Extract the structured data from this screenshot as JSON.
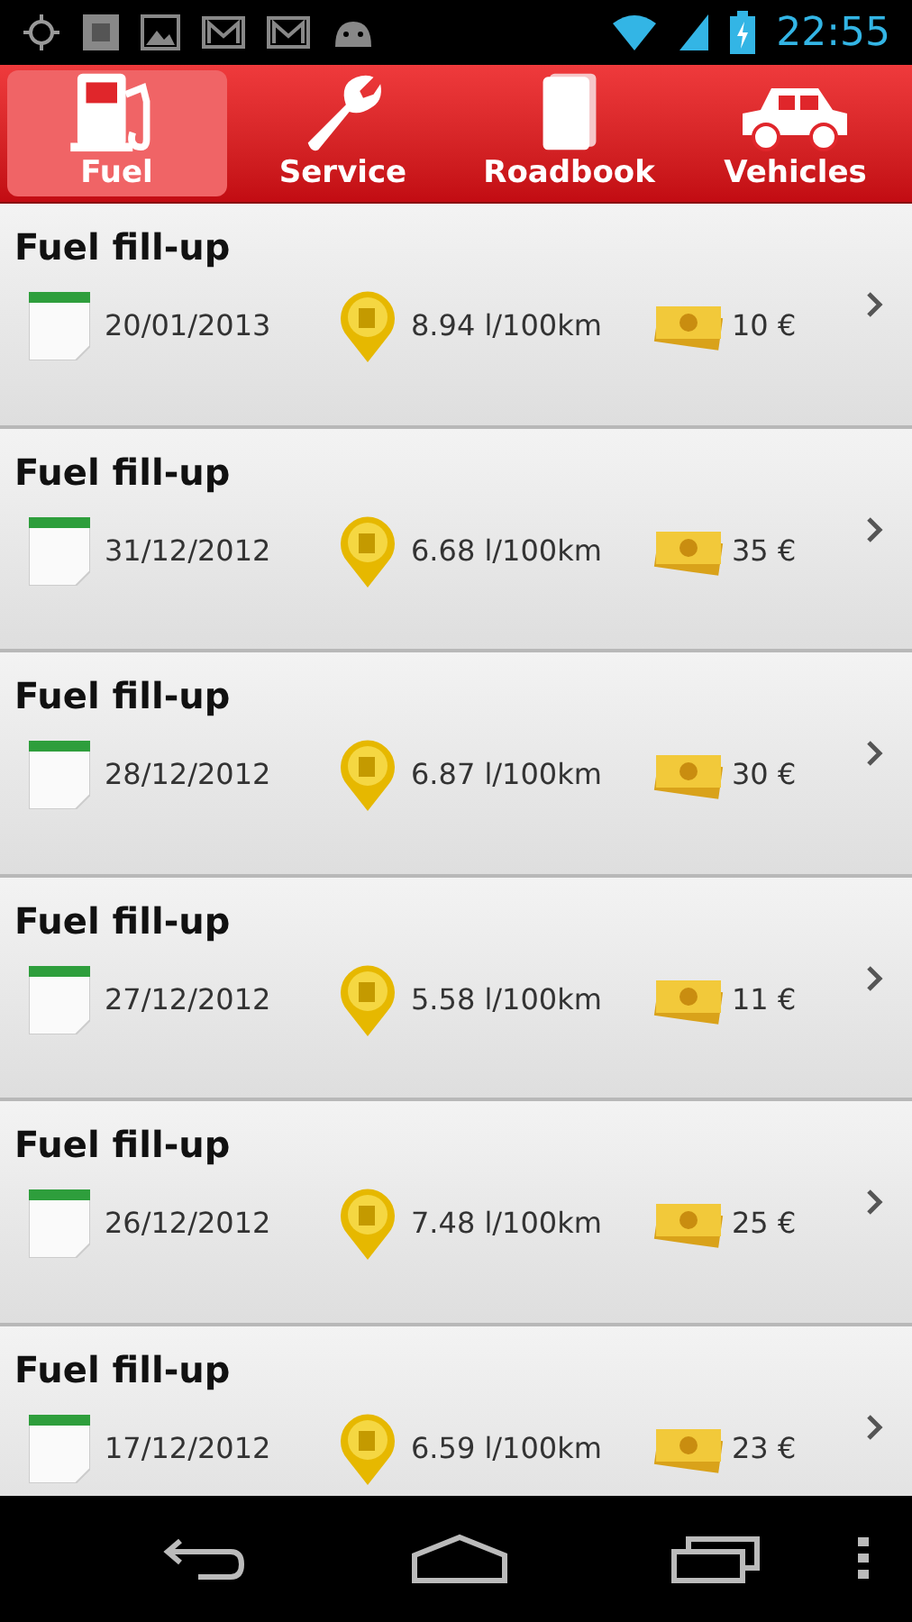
{
  "status_bar": {
    "time": "22:55"
  },
  "tabs": [
    {
      "label": "Fuel",
      "kind": "fuel",
      "selected": true
    },
    {
      "label": "Service",
      "kind": "service",
      "selected": false
    },
    {
      "label": "Roadbook",
      "kind": "roadbook",
      "selected": false
    },
    {
      "label": "Vehicles",
      "kind": "vehicles",
      "selected": false
    }
  ],
  "entries": [
    {
      "title": "Fuel fill-up",
      "date": "20/01/2013",
      "consumption": "8.94 l/100km",
      "cost": "10 €"
    },
    {
      "title": "Fuel fill-up",
      "date": "31/12/2012",
      "consumption": "6.68 l/100km",
      "cost": "35 €"
    },
    {
      "title": "Fuel fill-up",
      "date": "28/12/2012",
      "consumption": "6.87 l/100km",
      "cost": "30 €"
    },
    {
      "title": "Fuel fill-up",
      "date": "27/12/2012",
      "consumption": "5.58 l/100km",
      "cost": "11 €"
    },
    {
      "title": "Fuel fill-up",
      "date": "26/12/2012",
      "consumption": "7.48 l/100km",
      "cost": "25 €"
    },
    {
      "title": "Fuel fill-up",
      "date": "17/12/2012",
      "consumption": "6.59 l/100km",
      "cost": "23 €"
    }
  ]
}
